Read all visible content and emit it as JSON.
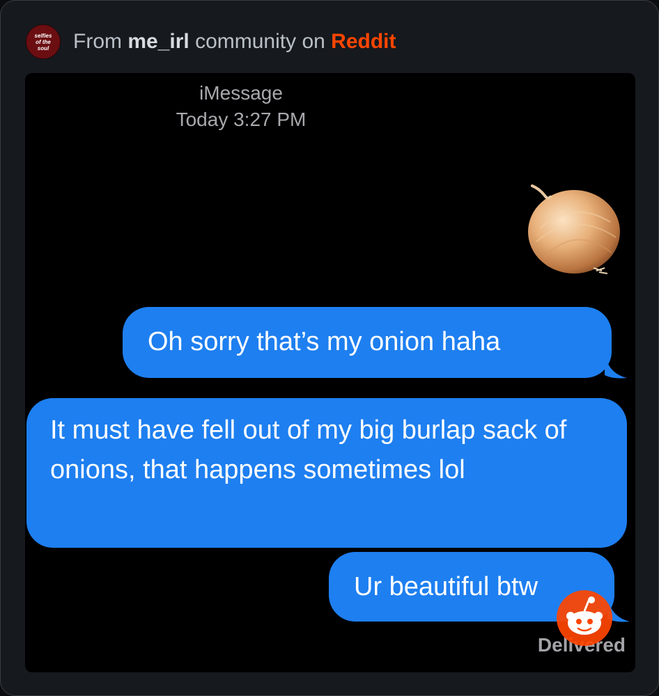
{
  "post": {
    "avatar_lines": [
      "selfies",
      "of the",
      "soul"
    ],
    "source_prefix": "From",
    "community": "me_irl",
    "source_middle": "community on",
    "platform": "Reddit"
  },
  "screenshot": {
    "service": "iMessage",
    "timestamp": "Today 3:27 PM",
    "image_content": "onion-emoji",
    "messages": [
      {
        "text": "Oh sorry that’s my onion haha",
        "sender": "me"
      },
      {
        "text": "It must have fell out of my big burlap sack of onions, that happens sometimes lol",
        "sender": "me"
      },
      {
        "text": "Ur beautiful btw",
        "sender": "me"
      }
    ],
    "status": "Delivered"
  },
  "overlay": {
    "icon": "reddit-snoo-icon"
  },
  "colors": {
    "card_background": "#16191d",
    "bubble_blue": "#1e7ff0",
    "reddit_orange": "#ff4500"
  }
}
